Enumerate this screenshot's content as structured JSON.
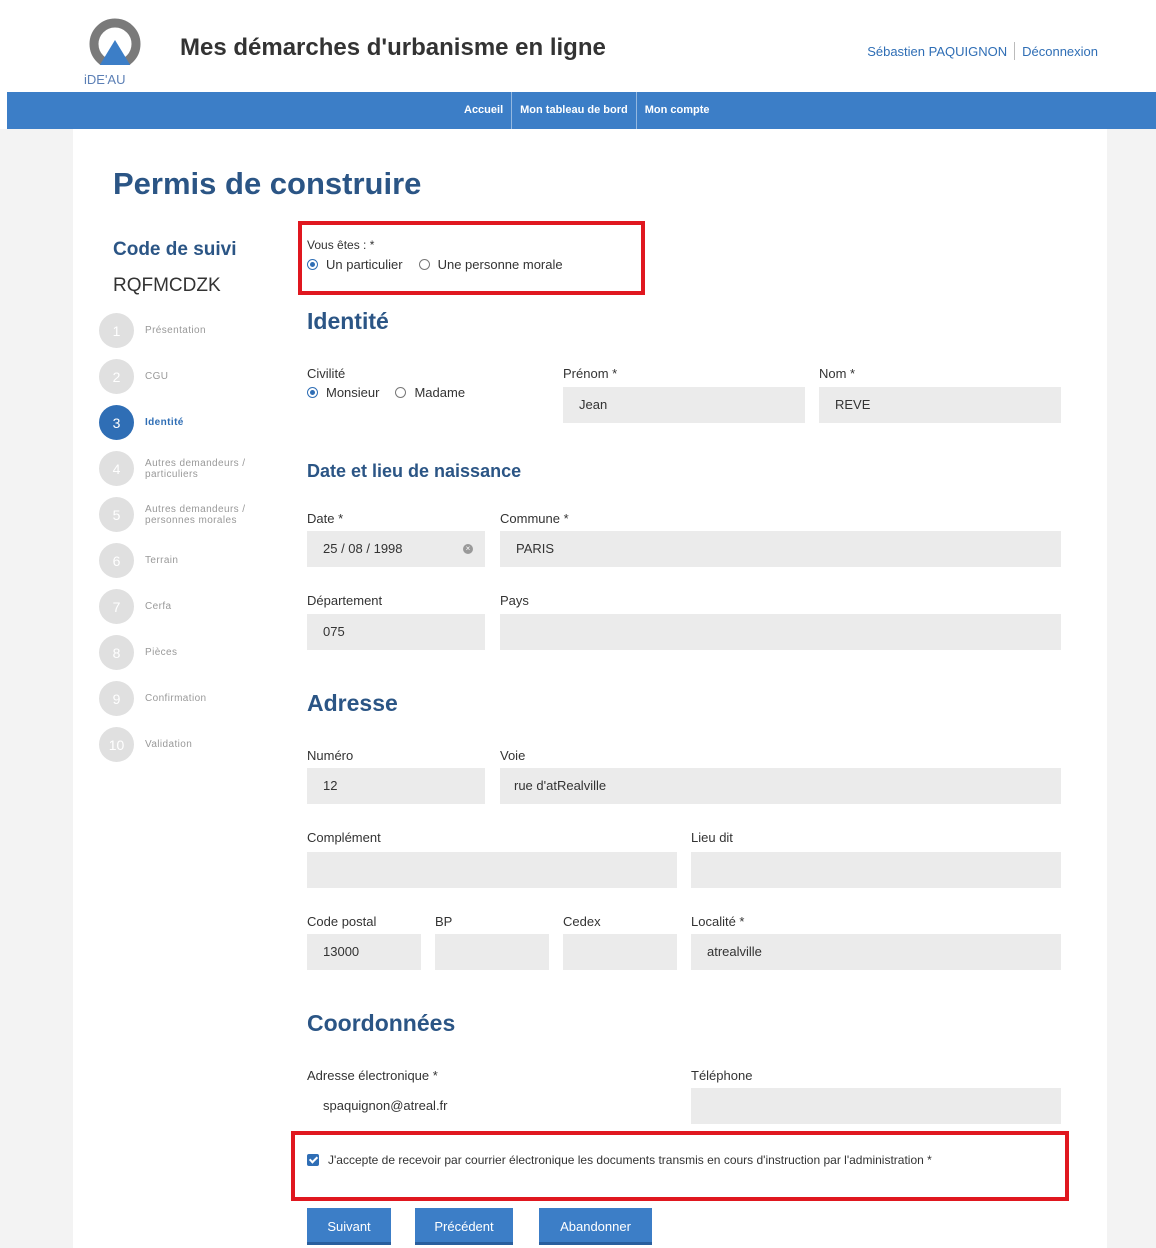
{
  "header": {
    "logo_text": "iDE'AU",
    "app_title": "Mes démarches d'urbanisme en ligne",
    "user_name": "Sébastien PAQUIGNON",
    "logout_label": "Déconnexion"
  },
  "nav": {
    "items": [
      {
        "label": "Accueil"
      },
      {
        "label": "Mon tableau de bord"
      },
      {
        "label": "Mon compte"
      }
    ]
  },
  "page": {
    "title": "Permis de construire",
    "tracking_label": "Code de suivi",
    "tracking_code": "RQFMCDZK"
  },
  "steps": [
    {
      "num": "1",
      "label": "Présentation"
    },
    {
      "num": "2",
      "label": "CGU"
    },
    {
      "num": "3",
      "label": "Identité",
      "active": true
    },
    {
      "num": "4",
      "label": "Autres demandeurs / particuliers"
    },
    {
      "num": "5",
      "label": "Autres demandeurs / personnes morales"
    },
    {
      "num": "6",
      "label": "Terrain"
    },
    {
      "num": "7",
      "label": "Cerfa"
    },
    {
      "num": "8",
      "label": "Pièces"
    },
    {
      "num": "9",
      "label": "Confirmation"
    },
    {
      "num": "10",
      "label": "Validation"
    }
  ],
  "form": {
    "vous_etes": {
      "label": "Vous êtes : *",
      "option1": "Un particulier",
      "option2": "Une personne morale",
      "selected": "Un particulier"
    },
    "identite": {
      "heading": "Identité",
      "civilite_label": "Civilité",
      "civ_option1": "Monsieur",
      "civ_option2": "Madame",
      "civ_selected": "Monsieur",
      "prenom_label": "Prénom *",
      "prenom_value": "Jean",
      "nom_label": "Nom *",
      "nom_value": "REVE"
    },
    "naissance": {
      "heading": "Date et lieu de naissance",
      "date_label": "Date *",
      "date_value": "25 / 08 / 1998",
      "commune_label": "Commune *",
      "commune_value": "PARIS",
      "departement_label": "Département",
      "departement_value": "075",
      "pays_label": "Pays",
      "pays_value": ""
    },
    "adresse": {
      "heading": "Adresse",
      "numero_label": "Numéro",
      "numero_value": "12",
      "voie_label": "Voie",
      "voie_value": "rue d'atRealville",
      "complement_label": "Complément",
      "complement_value": "",
      "lieudit_label": "Lieu dit",
      "lieudit_value": "",
      "cp_label": "Code postal",
      "cp_value": "13000",
      "bp_label": "BP",
      "bp_value": "",
      "cedex_label": "Cedex",
      "cedex_value": "",
      "localite_label": "Localité *",
      "localite_value": "atrealville"
    },
    "coordonnees": {
      "heading": "Coordonnées",
      "email_label": "Adresse électronique *",
      "email_value": "spaquignon@atreal.fr",
      "tel_label": "Téléphone",
      "tel_value": ""
    },
    "consent_text": "J'accepte de recevoir par courrier électronique les documents transmis en cours d'instruction par l'administration *",
    "consent_checked": true
  },
  "buttons": {
    "next": "Suivant",
    "prev": "Précédent",
    "abandon": "Abandonner"
  },
  "colors": {
    "brand_blue": "#3c7ec7",
    "heading_blue": "#2b5585",
    "highlight_red": "#e0171f"
  }
}
